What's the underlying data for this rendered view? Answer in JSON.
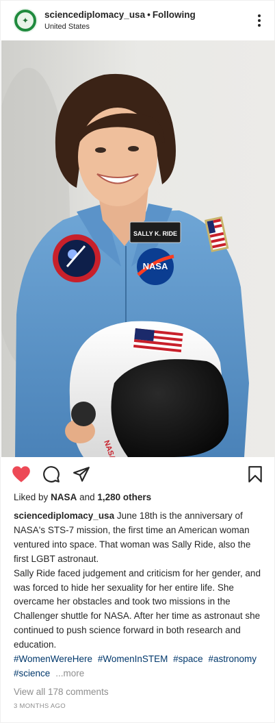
{
  "header": {
    "username": "sciencediplomacy_usa",
    "separator": "•",
    "follow_status": "Following",
    "location": "United States"
  },
  "photo": {
    "name_patch": "SALLY K. RIDE",
    "nasa_patch": "NASA"
  },
  "likes": {
    "prefix": "Liked by",
    "first": "NASA",
    "and": "and",
    "others": "1,280 others"
  },
  "caption": {
    "username": "sciencediplomacy_usa",
    "paragraph1": "June 18th is the anniversary of NASA's STS-7 mission, the first time an American woman ventured into space. That woman was Sally Ride, also the first LGBT astronaut.",
    "paragraph2": "Sally Ride faced judgement and criticism for her gender, and was forced to hide her sexuality for her entire life. She overcame her obstacles and took two missions in the Challenger shuttle for NASA. After her time as astronaut she continued to push science forward in both research and education.",
    "hashtags": [
      "#WomenWereHere",
      "#WomenInSTEM",
      "#space",
      "#astronomy",
      "#science"
    ],
    "more": "...more"
  },
  "comments": {
    "view_all": "View all 178 comments"
  },
  "timestamp": "3 MONTHS AGO",
  "colors": {
    "like_red": "#ed4956",
    "hashtag_blue": "#00376b",
    "muted": "#8e8e8e"
  },
  "icons": [
    "eagle-seal-icon",
    "more-options-icon",
    "heart-icon",
    "comment-icon",
    "share-icon",
    "bookmark-icon"
  ]
}
